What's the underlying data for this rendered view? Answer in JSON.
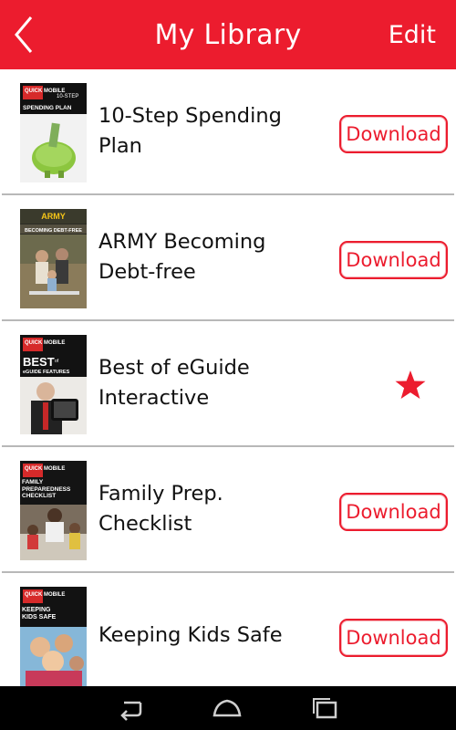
{
  "header": {
    "title": "My Library",
    "edit_label": "Edit",
    "back_icon": "back-chevron-icon",
    "accent_color": "#ec1c2e"
  },
  "books": [
    {
      "title_line1": "10-Step Spending",
      "title_line2": "Plan",
      "action": "download",
      "action_label": "Download",
      "cover": {
        "brand": "QUICK MOBILE",
        "tag": "10-STEP",
        "headline": "SPENDING PLAN"
      }
    },
    {
      "title_line1": "ARMY Becoming",
      "title_line2": "Debt-free",
      "action": "download",
      "action_label": "Download",
      "cover": {
        "brand": "ARMY",
        "headline": "BECOMING DEBT-FREE"
      }
    },
    {
      "title_line1": "Best of eGuide",
      "title_line2": "Interactive",
      "action": "favorite",
      "action_icon": "star-icon",
      "cover": {
        "brand": "QUICK MOBILE",
        "headline": "BEST",
        "sub": "of",
        "headline2": "eGUIDE FEATURES"
      }
    },
    {
      "title_line1": "Family Prep.",
      "title_line2": "Checklist",
      "action": "download",
      "action_label": "Download",
      "cover": {
        "brand": "QUICK MOBILE",
        "headline": "FAMILY PREPAREDNESS CHECKLIST"
      }
    },
    {
      "title_line1": "Keeping Kids Safe",
      "title_line2": "",
      "action": "download",
      "action_label": "Download",
      "cover": {
        "brand": "QUICK MOBILE",
        "headline": "KEEPING KIDS SAFE"
      }
    }
  ],
  "system_nav": {
    "back_icon": "nav-back-icon",
    "home_icon": "nav-home-icon",
    "recents_icon": "nav-recents-icon"
  }
}
